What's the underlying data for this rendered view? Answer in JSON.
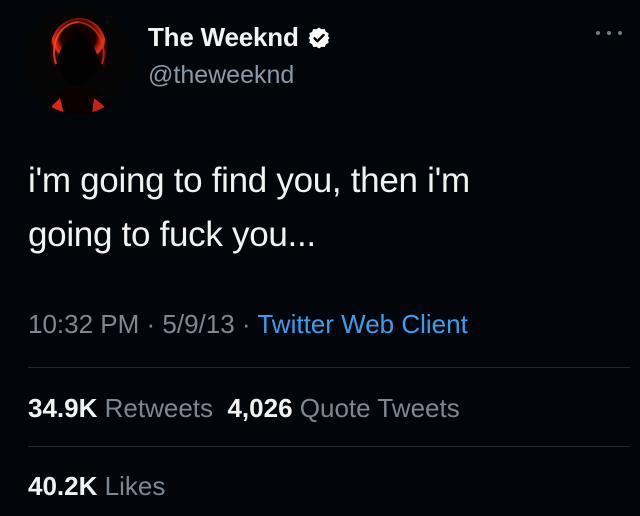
{
  "author": {
    "display_name": "The Weeknd",
    "handle": "@theweeknd",
    "verified": true,
    "avatar_icon": "profile-avatar"
  },
  "menu_icon": "more-options-icon",
  "tweet": {
    "text_line1": "i'm going to find you, then i'm",
    "text_line2": "going to fuck you..."
  },
  "meta": {
    "time": "10:32 PM",
    "sep1": " · ",
    "date": "5/9/13",
    "sep2": " · ",
    "client": "Twitter Web Client"
  },
  "stats": {
    "retweets_count": "34.9K",
    "retweets_label": "Retweets",
    "quotes_count": "4,026",
    "quotes_label": "Quote Tweets",
    "likes_count": "40.2K",
    "likes_label": "Likes"
  },
  "colors": {
    "background": "#020509",
    "link": "#3a9ef0",
    "muted": "#7d8791",
    "verified_badge": "#ffffff"
  }
}
